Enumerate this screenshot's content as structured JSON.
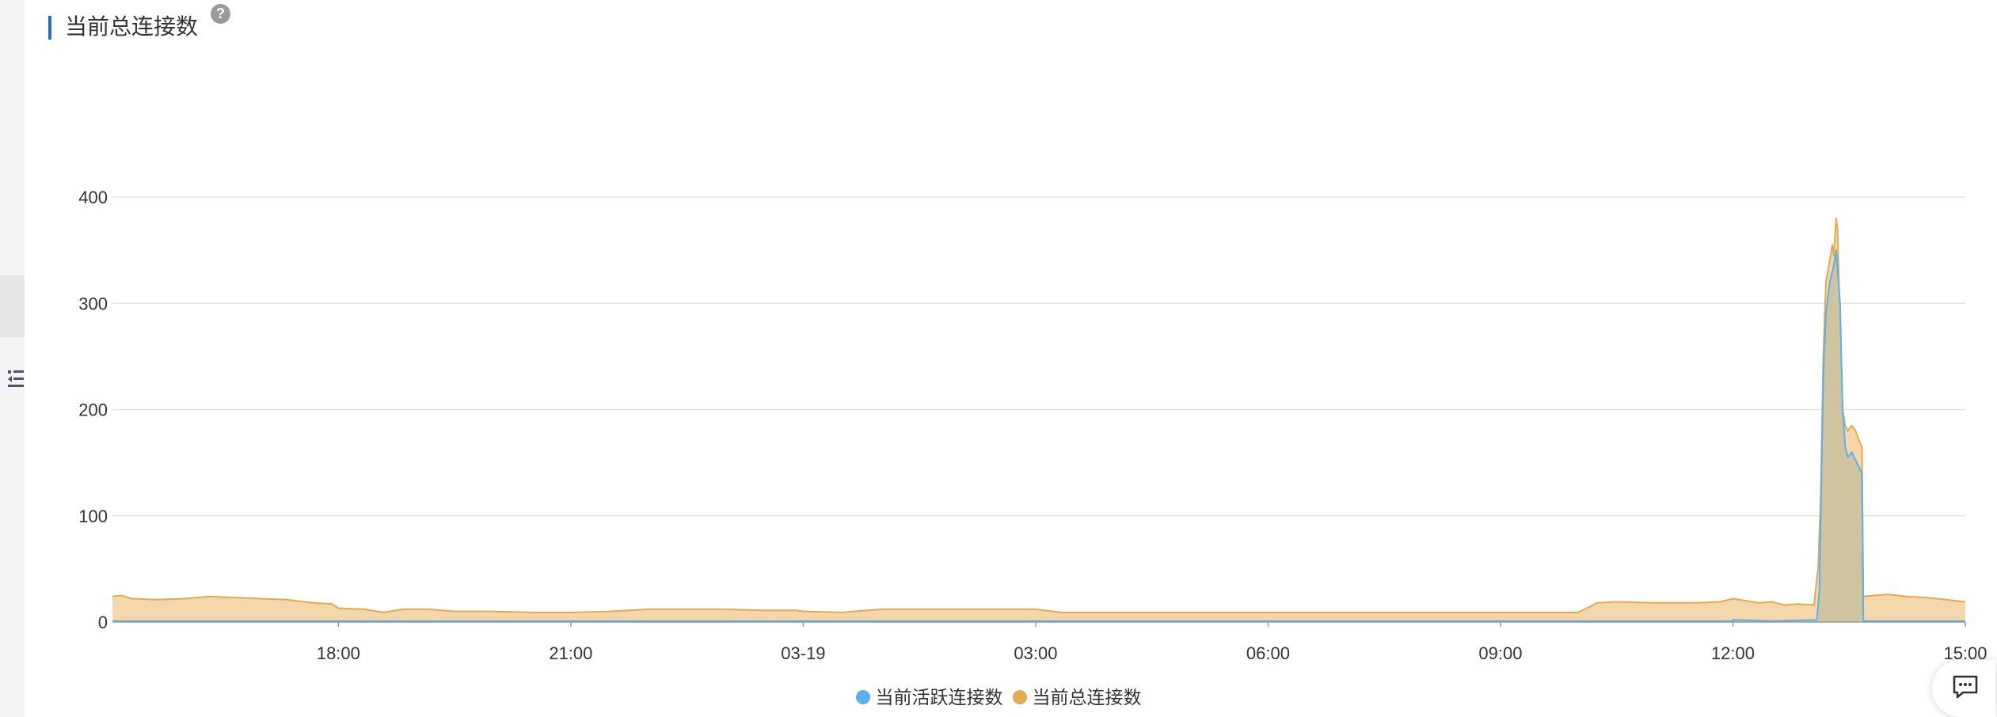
{
  "panel": {
    "title": "当前总连接数",
    "help_icon": "?"
  },
  "icons": {
    "help": "question-circle-icon",
    "sidebar_toggle": "collapse-list-icon",
    "chat": "chat-message-icon"
  },
  "colors": {
    "title_accent": "#1f6fd0",
    "active_series": "#5ab1ef",
    "total_series": "#e5a94e",
    "total_fill": "#f4d3a3",
    "overlap_fill": "#c9c09c",
    "grid": "#e3e3e3"
  },
  "chart_data": {
    "type": "area",
    "title": "当前总连接数",
    "xlabel": "",
    "ylabel": "",
    "ylim": [
      0,
      400
    ],
    "y_ticks": [
      0,
      100,
      200,
      300,
      400
    ],
    "x_range": [
      "03-18 15:05",
      "03-19 15:00"
    ],
    "x_ticks": [
      {
        "label": "18:00",
        "t": "03-18 18:00"
      },
      {
        "label": "21:00",
        "t": "03-18 21:00"
      },
      {
        "label": "03-19",
        "t": "03-19 00:00"
      },
      {
        "label": "03:00",
        "t": "03-19 03:00"
      },
      {
        "label": "06:00",
        "t": "03-19 06:00"
      },
      {
        "label": "09:00",
        "t": "03-19 09:00"
      },
      {
        "label": "12:00",
        "t": "03-19 12:00"
      },
      {
        "label": "15:00",
        "t": "03-19 15:00"
      }
    ],
    "grid": true,
    "legend_position": "bottom-center",
    "series": [
      {
        "name": "当前活跃连接数",
        "color": "#5ab1ef",
        "points": [
          [
            "03-18 15:05",
            1
          ],
          [
            "03-18 18:00",
            1
          ],
          [
            "03-19 00:00",
            1
          ],
          [
            "03-19 06:00",
            1
          ],
          [
            "03-19 12:00",
            1
          ],
          [
            "03-19 12:00",
            2
          ],
          [
            "03-19 12:30",
            1
          ],
          [
            "03-19 13:05",
            2
          ],
          [
            "03-19 13:07",
            30
          ],
          [
            "03-19 13:10",
            230
          ],
          [
            "03-19 13:12",
            290
          ],
          [
            "03-19 13:15",
            320
          ],
          [
            "03-19 13:18",
            335
          ],
          [
            "03-19 13:20",
            350
          ],
          [
            "03-19 13:23",
            300
          ],
          [
            "03-19 13:25",
            200
          ],
          [
            "03-19 13:27",
            165
          ],
          [
            "03-19 13:29",
            155
          ],
          [
            "03-19 13:32",
            160
          ],
          [
            "03-19 13:36",
            150
          ],
          [
            "03-19 13:40",
            140
          ],
          [
            "03-19 13:41",
            1
          ],
          [
            "03-19 15:00",
            1
          ]
        ]
      },
      {
        "name": "当前总连接数",
        "color": "#e5a94e",
        "points": [
          [
            "03-18 15:05",
            24
          ],
          [
            "03-18 15:12",
            25
          ],
          [
            "03-18 15:20",
            22
          ],
          [
            "03-18 15:40",
            21
          ],
          [
            "03-18 16:00",
            22
          ],
          [
            "03-18 16:20",
            24
          ],
          [
            "03-18 16:40",
            23
          ],
          [
            "03-18 17:00",
            22
          ],
          [
            "03-18 17:20",
            21
          ],
          [
            "03-18 17:40",
            18
          ],
          [
            "03-18 17:55",
            17
          ],
          [
            "03-18 18:00",
            13
          ],
          [
            "03-18 18:20",
            12
          ],
          [
            "03-18 18:35",
            9
          ],
          [
            "03-18 18:50",
            12
          ],
          [
            "03-18 19:10",
            12
          ],
          [
            "03-18 19:30",
            10
          ],
          [
            "03-18 20:00",
            10
          ],
          [
            "03-18 20:30",
            9
          ],
          [
            "03-18 21:00",
            9
          ],
          [
            "03-18 21:30",
            10
          ],
          [
            "03-18 22:00",
            12
          ],
          [
            "03-18 22:30",
            12
          ],
          [
            "03-18 23:00",
            12
          ],
          [
            "03-18 23:30",
            11
          ],
          [
            "03-18 23:55",
            11
          ],
          [
            "03-19 00:00",
            10
          ],
          [
            "03-19 00:30",
            9
          ],
          [
            "03-19 01:00",
            12
          ],
          [
            "03-19 01:30",
            12
          ],
          [
            "03-19 02:00",
            12
          ],
          [
            "03-19 02:30",
            12
          ],
          [
            "03-19 03:00",
            12
          ],
          [
            "03-19 03:20",
            9
          ],
          [
            "03-19 04:00",
            9
          ],
          [
            "03-19 05:00",
            9
          ],
          [
            "03-19 06:00",
            9
          ],
          [
            "03-19 07:00",
            9
          ],
          [
            "03-19 08:00",
            9
          ],
          [
            "03-19 09:00",
            9
          ],
          [
            "03-19 10:00",
            9
          ],
          [
            "03-19 10:05",
            12
          ],
          [
            "03-19 10:15",
            18
          ],
          [
            "03-19 10:30",
            19
          ],
          [
            "03-19 11:00",
            18
          ],
          [
            "03-19 11:30",
            18
          ],
          [
            "03-19 11:50",
            19
          ],
          [
            "03-19 12:00",
            22
          ],
          [
            "03-19 12:10",
            20
          ],
          [
            "03-19 12:20",
            18
          ],
          [
            "03-19 12:30",
            19
          ],
          [
            "03-19 12:40",
            16
          ],
          [
            "03-19 12:50",
            17
          ],
          [
            "03-19 13:03",
            16
          ],
          [
            "03-19 13:04",
            30
          ],
          [
            "03-19 13:06",
            50
          ],
          [
            "03-19 13:08",
            120
          ],
          [
            "03-19 13:10",
            250
          ],
          [
            "03-19 13:12",
            320
          ],
          [
            "03-19 13:15",
            340
          ],
          [
            "03-19 13:17",
            355
          ],
          [
            "03-19 13:18",
            345
          ],
          [
            "03-19 13:20",
            380
          ],
          [
            "03-19 13:21",
            370
          ],
          [
            "03-19 13:23",
            280
          ],
          [
            "03-19 13:25",
            200
          ],
          [
            "03-19 13:27",
            185
          ],
          [
            "03-19 13:29",
            180
          ],
          [
            "03-19 13:32",
            185
          ],
          [
            "03-19 13:35",
            180
          ],
          [
            "03-19 13:38",
            170
          ],
          [
            "03-19 13:40",
            165
          ],
          [
            "03-19 13:41",
            24
          ],
          [
            "03-19 13:50",
            25
          ],
          [
            "03-19 14:00",
            26
          ],
          [
            "03-19 14:15",
            24
          ],
          [
            "03-19 14:30",
            23
          ],
          [
            "03-19 14:45",
            21
          ],
          [
            "03-19 15:00",
            19
          ]
        ]
      }
    ]
  },
  "legend": {
    "active_label": "当前活跃连接数",
    "total_label": "当前总连接数"
  }
}
